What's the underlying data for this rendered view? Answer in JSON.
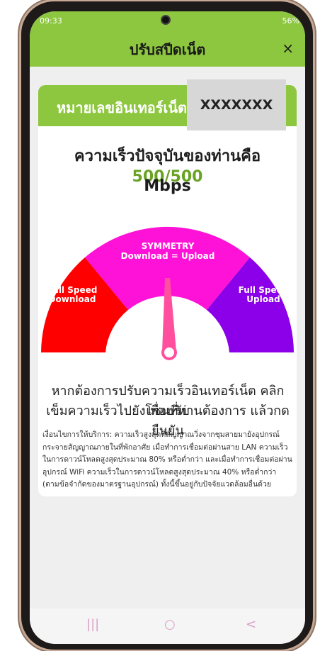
{
  "status_bar": {
    "time": "09:33",
    "right": "56%"
  },
  "app_bar": {
    "title": "ปรับสปีดเน็ต",
    "close_symbol": "×"
  },
  "banner": {
    "label": "หมายเลขอินเทอร์เน็ต",
    "number": "XXXXXXX"
  },
  "speed": {
    "prefix": "ความเร็วปัจจุบันของท่านคือ",
    "value": "500/500",
    "unit": "Mbps"
  },
  "gauge": {
    "left_label_1": "Full Speed",
    "left_label_2": "Download",
    "center_label_1": "SYMMETRY",
    "center_label_2": "Download = Upload",
    "right_label_1": "Full Speed",
    "right_label_2": "Upload",
    "colors": {
      "left": "#ff0000",
      "center": "#ff12d7",
      "right": "#8b00e8",
      "needle": "#ff4f9d"
    }
  },
  "instruction": {
    "line1": "หากต้องการปรับความเร็วอินเทอร์เน็ต คลิกเพื่อปรับ",
    "line2": "เข็มความเร็วไปยังโซนที่ท่านต้องการ แล้วกดยืนยัน"
  },
  "note": "เงื่อนไขการให้บริการ: ความเร็วสูงสุดที่สัญญาณวิ่งจากชุมสายมายังอุปกรณ์กระจายสัญญาณภายในที่พักอาศัย เมื่อทำการเชื่อมต่อผ่านสาย LAN ความเร็วในการดาวน์โหลดสูงสุดประมาณ 80% หรือต่ำกว่า และเมื่อทำการเชื่อมต่อผ่านอุปกรณ์ WiFi ความเร็วในการดาวน์โหลดสูงสุดประมาณ 40% หรือต่ำกว่า (ตามข้อจำกัดของมาตรฐานอุปกรณ์) ทั้งนี้ขึ้นอยู่กับปัจจัยแวดล้อมอื่นด้วย",
  "nav": {
    "recent": "|||",
    "home": "○",
    "back": "<"
  }
}
